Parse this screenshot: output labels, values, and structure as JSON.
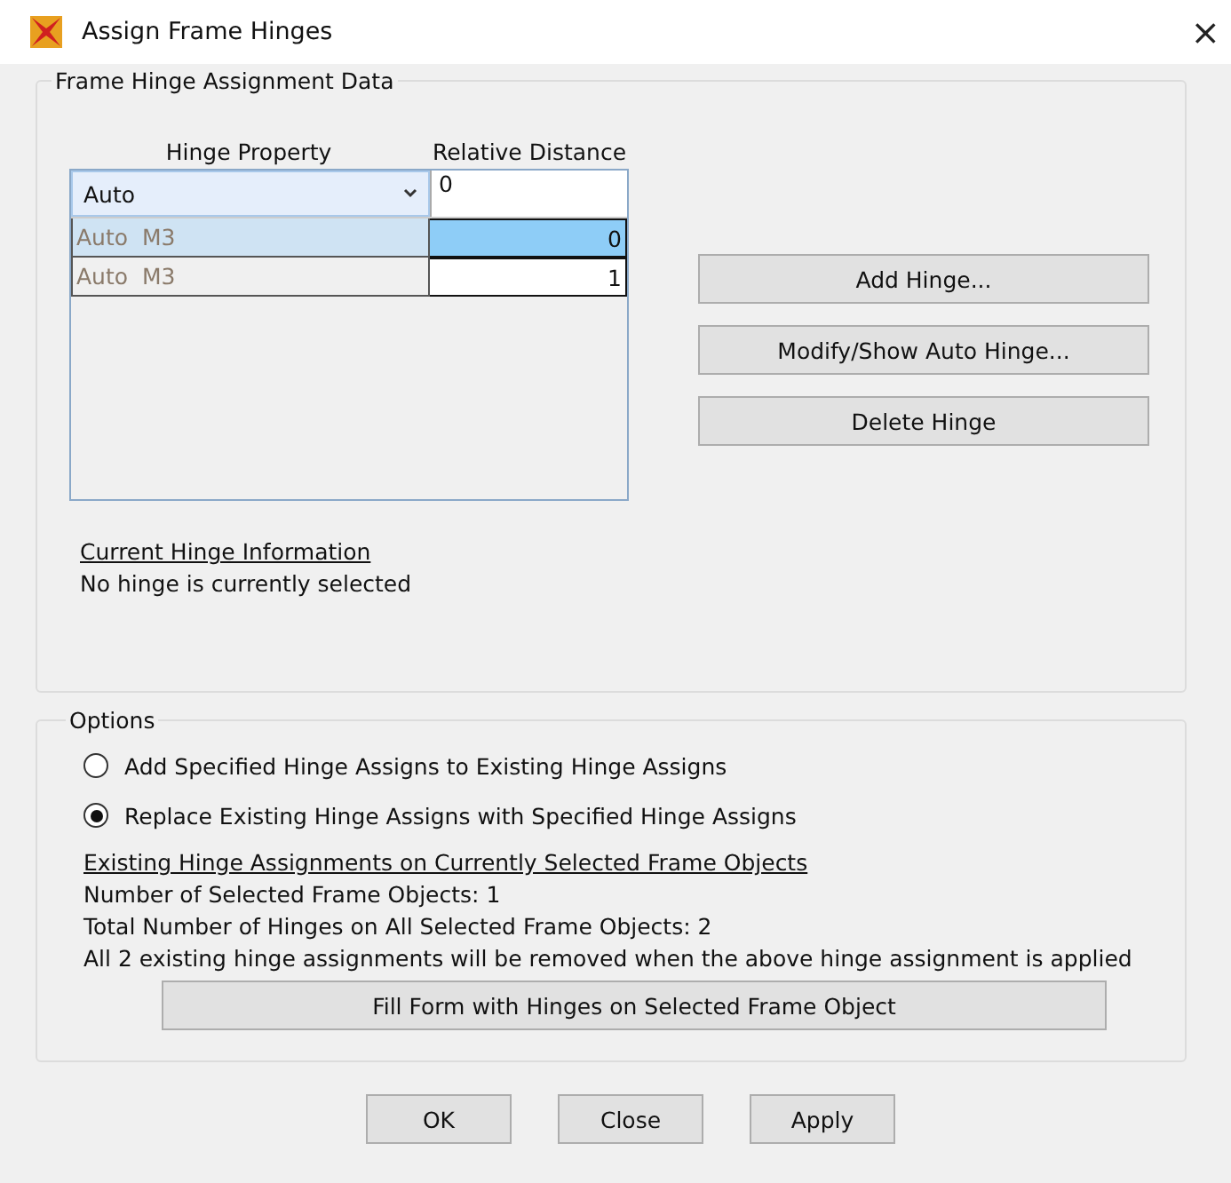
{
  "window": {
    "title": "Assign Frame Hinges",
    "close": "×"
  },
  "hinge_data": {
    "legend": "Frame Hinge Assignment Data",
    "columns": [
      "Hinge Property",
      "Relative Distance"
    ],
    "input": {
      "property": "Auto",
      "distance": "0"
    },
    "rows": [
      {
        "property": "Auto  M3",
        "distance": "0",
        "selected": true
      },
      {
        "property": "Auto  M3",
        "distance": "1",
        "selected": false
      }
    ],
    "buttons": [
      "Add Hinge...",
      "Modify/Show Auto Hinge...",
      "Delete Hinge"
    ],
    "info_heading": "Current Hinge Information",
    "info_text": "No hinge is currently selected"
  },
  "options": {
    "legend": "Options",
    "radios": [
      {
        "label": "Add Specified Hinge Assigns to Existing Hinge Assigns",
        "selected": false
      },
      {
        "label": "Replace Existing Hinge Assigns with Specified Hinge Assigns",
        "selected": true
      }
    ],
    "existing_heading": "Existing Hinge Assignments on Currently Selected Frame Objects",
    "lines": [
      "Number of Selected Frame Objects:  1",
      "Total Number of Hinges on All Selected Frame Objects:  2",
      "All 2 existing hinge assignments will be removed when the above hinge assignment is applied"
    ],
    "fill_button": "Fill Form with Hinges on Selected Frame Object"
  },
  "buttons": [
    "OK",
    "Close",
    "Apply"
  ]
}
